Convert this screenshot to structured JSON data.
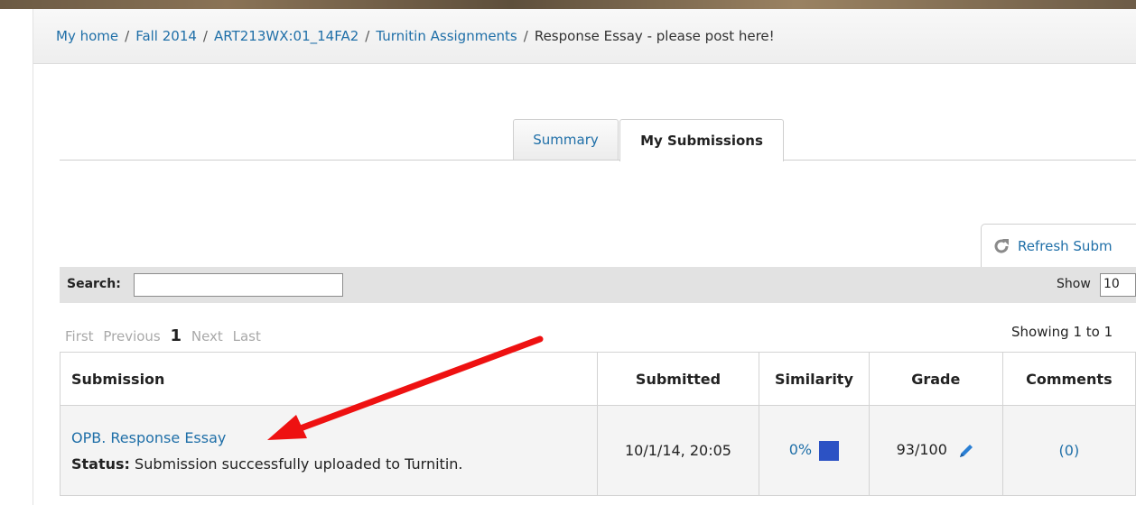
{
  "breadcrumb": {
    "items": [
      "My home",
      "Fall 2014",
      "ART213WX:01_14FA2",
      "Turnitin Assignments"
    ],
    "current": "Response Essay - please post here!",
    "separator": "/"
  },
  "tabs": {
    "summary": "Summary",
    "my_submissions": "My Submissions"
  },
  "refresh_label": "Refresh Subm",
  "search": {
    "label": "Search:",
    "value": ""
  },
  "show": {
    "label": "Show",
    "value": "10"
  },
  "pager": {
    "first": "First",
    "previous": "Previous",
    "current": "1",
    "next": "Next",
    "last": "Last"
  },
  "showing_text": "Showing 1 to 1",
  "table": {
    "headers": {
      "submission": "Submission",
      "submitted": "Submitted",
      "similarity": "Similarity",
      "grade": "Grade",
      "comments": "Comments"
    },
    "rows": [
      {
        "title": "OPB. Response Essay",
        "status_label": "Status:",
        "status_text": "Submission successfully uploaded to Turnitin.",
        "submitted": "10/1/14, 20:05",
        "similarity": "0%",
        "grade": "93/100",
        "comments": "(0)"
      }
    ]
  },
  "colors": {
    "link": "#1f6fa8",
    "similarity_box": "#2c52c4",
    "arrow": "#ee1111",
    "pencil": "#2a7fd4"
  },
  "icons": {
    "refresh": "refresh-icon",
    "grade": "pencil-icon",
    "arrow": "arrow-annotation"
  }
}
